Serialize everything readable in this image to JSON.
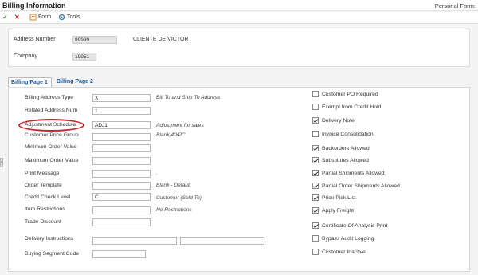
{
  "window": {
    "title": "Billing Information",
    "personal_form": "Personal Form:"
  },
  "toolbar": {
    "form_label": "Form",
    "tools_label": "Tools"
  },
  "header": {
    "address_number_label": "Address Number",
    "address_number_value": "99999",
    "customer_name": "CLIENTE DE VICTOR",
    "company_label": "Company",
    "company_value": "19951"
  },
  "tabs": [
    {
      "label": "Billing Page 1",
      "active": true
    },
    {
      "label": "Billing Page 2",
      "active": false
    }
  ],
  "fields": {
    "billing_address_type": {
      "label": "Billing Address Type",
      "value": "X",
      "description": "Bill To and Ship To Address"
    },
    "related_address_num": {
      "label": "Related Address Num",
      "value": "1",
      "description": ""
    },
    "adjustment_schedule": {
      "label": "Adjustment Schedule",
      "value": "ADJ1",
      "description": "Adjustment for sales"
    },
    "customer_price_group": {
      "label": "Customer Price Group",
      "value": "",
      "description": "Blank 40/PC"
    },
    "minimum_order_value": {
      "label": "Minimum Order Value",
      "value": "",
      "description": ""
    },
    "maximum_order_value": {
      "label": "Maximum Order Value",
      "value": "",
      "description": ""
    },
    "print_message": {
      "label": "Print Message",
      "value": "",
      "description": "."
    },
    "order_template": {
      "label": "Order Template",
      "value": "",
      "description": "Blank - Default"
    },
    "credit_check_level": {
      "label": "Credit Check Level",
      "value": "C",
      "description": "Customer (Sold To)"
    },
    "item_restrictions": {
      "label": "Item Restrictions",
      "value": "",
      "description": "No Restrictions"
    },
    "trade_discount": {
      "label": "Trade Discount",
      "value": "",
      "description": ""
    },
    "delivery_instructions": {
      "label": "Delivery Instructions",
      "value1": "",
      "value2": ""
    },
    "buying_segment_code": {
      "label": "Buying Segment Code",
      "value": ""
    }
  },
  "checkboxes": [
    {
      "label": "Customer PO Required",
      "checked": false
    },
    {
      "label": "Exempt from Credit Hold",
      "checked": false
    },
    {
      "label": "Delivery Note",
      "checked": true
    },
    {
      "label": "Invoice Consolidation",
      "checked": false
    },
    {
      "label": "Backorders Allowed",
      "checked": true
    },
    {
      "label": "Substitutes Allowed",
      "checked": true
    },
    {
      "label": "Partial Shipments Allowed",
      "checked": true
    },
    {
      "label": "Partial Order Shipments Allowed",
      "checked": true
    },
    {
      "label": "Price Pick List",
      "checked": true
    },
    {
      "label": "Apply Freight",
      "checked": true
    },
    {
      "label": "Certificate Of Analysis Print",
      "checked": true
    },
    {
      "label": "Bypass Audit Logging",
      "checked": false
    },
    {
      "label": "Customer Inactive",
      "checked": false
    }
  ],
  "colors": {
    "highlight": "#c8262c",
    "tab_text": "#1a5a99",
    "ok": "#2f7a2f",
    "cancel": "#c83030"
  },
  "icons": [
    "check-icon",
    "close-icon",
    "form-icon",
    "tools-icon",
    "expand-handle-icon"
  ]
}
